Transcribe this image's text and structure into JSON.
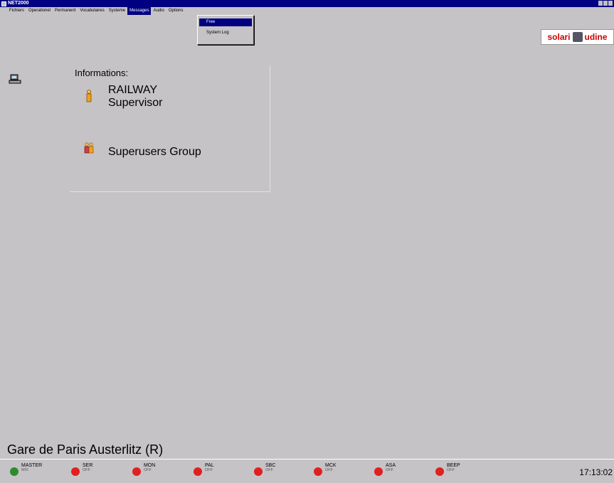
{
  "window": {
    "title": "NET2000"
  },
  "menu": {
    "items": [
      {
        "label": "Fichiers"
      },
      {
        "label": "Operationel"
      },
      {
        "label": "Permanent"
      },
      {
        "label": "Vocabulaires"
      },
      {
        "label": "Systeme"
      },
      {
        "label": "Messages"
      },
      {
        "label": "Audio"
      },
      {
        "label": "Options"
      }
    ],
    "active_index": 5,
    "dropdown": [
      {
        "label": "Free"
      },
      {
        "label": "System Log"
      }
    ]
  },
  "logo": {
    "left": "solari",
    "right": "udine"
  },
  "info": {
    "title": "Informations:",
    "user_line1": "RAILWAY",
    "user_line2": "Supervisor",
    "group": "Superusers Group"
  },
  "station": {
    "name": "Gare de Paris Austerlitz (R)"
  },
  "status": {
    "indicators": [
      {
        "name": "MASTER",
        "state": "MIX",
        "color": "#2e8b2e"
      },
      {
        "name": "SER",
        "state": "OFF",
        "color": "#e02020"
      },
      {
        "name": "MON",
        "state": "OFF",
        "color": "#e02020"
      },
      {
        "name": "PAL",
        "state": "OFF",
        "color": "#e02020"
      },
      {
        "name": "SBC",
        "state": "OFF",
        "color": "#e02020"
      },
      {
        "name": "MCK",
        "state": "OFF",
        "color": "#e02020"
      },
      {
        "name": "ASA",
        "state": "OFF",
        "color": "#e02020"
      },
      {
        "name": "BEEP",
        "state": "OFF",
        "color": "#e02020"
      }
    ],
    "clock": "17:13:02"
  },
  "icons": {
    "side": "pc-icon",
    "user": "user-icon",
    "group": "group-icon"
  }
}
